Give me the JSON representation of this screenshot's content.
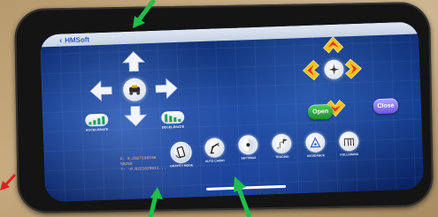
{
  "header": {
    "back_chevron": "‹",
    "back_label": "HMSoft"
  },
  "left_pad": {
    "up_icon": "arrow-up-icon",
    "down_icon": "arrow-down-icon",
    "left_icon": "arrow-left-icon",
    "right_icon": "arrow-right-icon",
    "center_icon": "robot-car-icon",
    "accelerate_label": "ACCELERATE",
    "decelerate_label": "DECELERATE"
  },
  "right_pad": {
    "up_icon": "chevron-up-icon",
    "down_icon": "chevron-down-icon",
    "left_icon": "chevron-left-icon",
    "right_icon": "chevron-right-icon",
    "center_icon": "gripper-icon",
    "open_label": "Open",
    "close_label": "Close"
  },
  "coordinates": {
    "line1": "X: 0.2027190109",
    "line2": "58258",
    "line3": "Y: -0.0221028611..."
  },
  "modes": [
    {
      "label": "GRAVITY MODE",
      "icon": "phone-tilt-icon",
      "selected": true
    },
    {
      "label": "AUTO CARRY",
      "icon": "robot-arm-icon",
      "selected": false
    },
    {
      "label": "SETTINGS",
      "icon": "dial-icon",
      "selected": false
    },
    {
      "label": "TRACING",
      "icon": "path-flag-icon",
      "selected": false
    },
    {
      "label": "AVOIDANCE",
      "icon": "obstacle-icon",
      "selected": false
    },
    {
      "label": "FOLLOWING",
      "icon": "line-follow-icon",
      "selected": false
    }
  ],
  "colors": {
    "accent_arrow_red": "#e0322a",
    "accent_arrow_yellow": "#f3c21b",
    "open_green": "#1d8b2d",
    "close_purple": "#6d55e0",
    "annotation_green": "#1fbf4a",
    "annotation_red": "#e02020"
  }
}
